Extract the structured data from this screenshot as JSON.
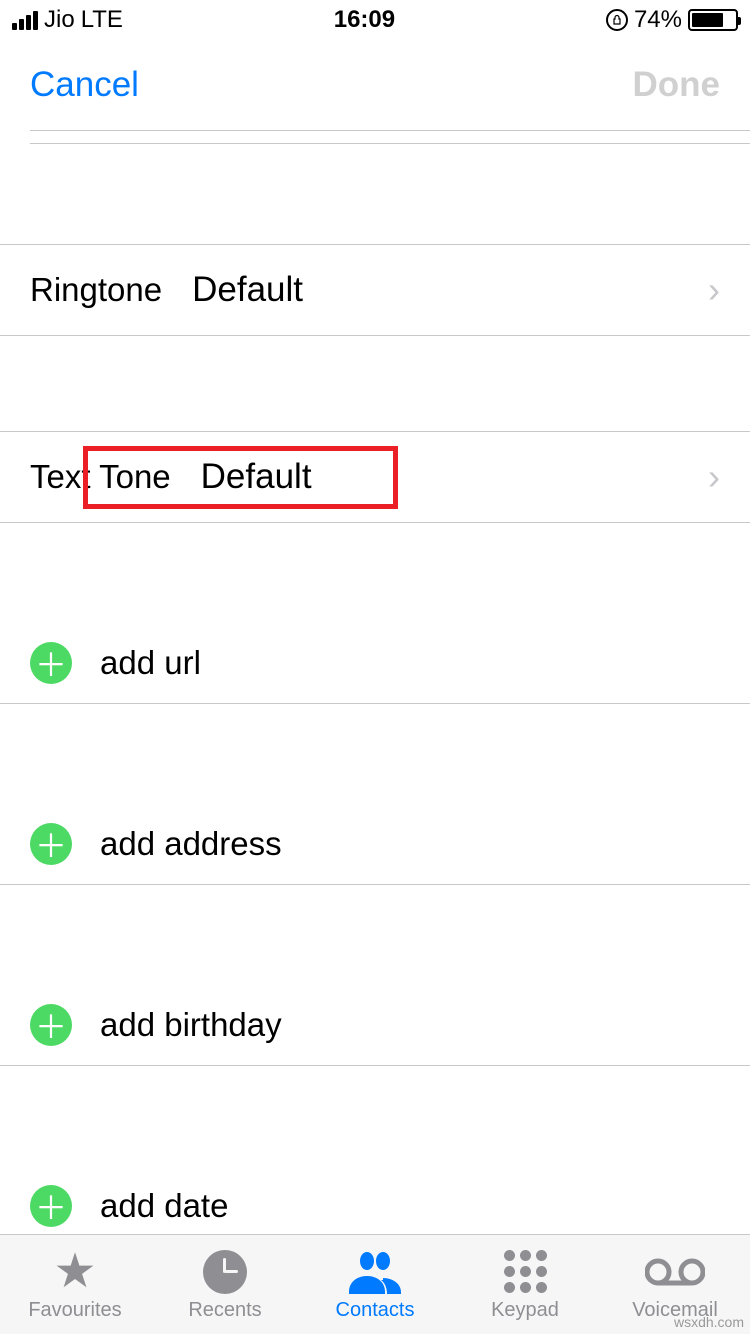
{
  "status": {
    "carrier": "Jio",
    "network": "LTE",
    "time": "16:09",
    "battery_percent": "74%"
  },
  "nav": {
    "cancel": "Cancel",
    "done": "Done"
  },
  "rows": {
    "ringtone_label": "Ringtone",
    "ringtone_value": "Default",
    "texttone_label": "Text Tone",
    "texttone_value": "Default"
  },
  "add": {
    "url": "add url",
    "address": "add address",
    "birthday": "add birthday",
    "date": "add date"
  },
  "tabs": {
    "favourites": "Favourites",
    "recents": "Recents",
    "contacts": "Contacts",
    "keypad": "Keypad",
    "voicemail": "Voicemail"
  },
  "watermark": "wsxdh.com"
}
